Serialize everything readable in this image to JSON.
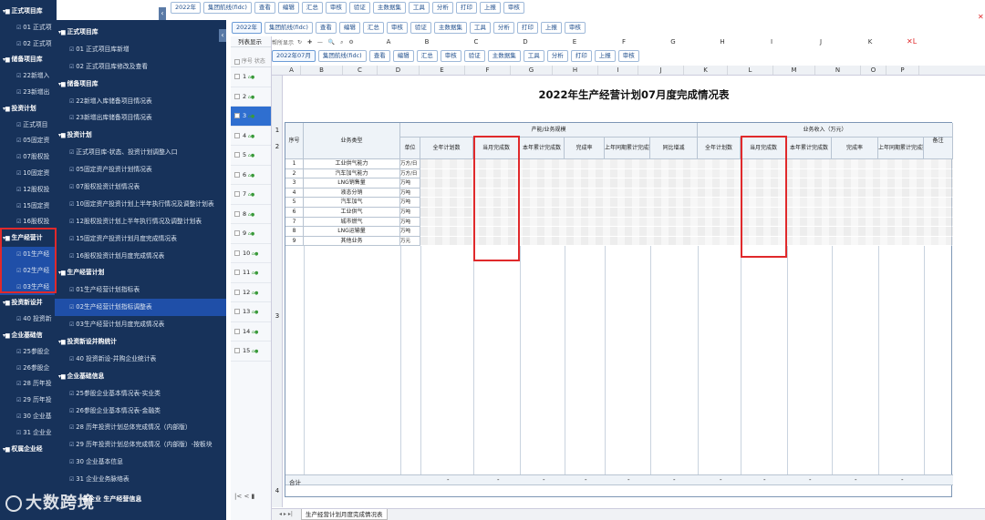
{
  "back_window": {
    "toolbar": [
      "2022年",
      "集团航线(fidc)",
      "查看",
      "编辑",
      "汇总",
      "审核",
      "验证",
      "主数据集",
      "工具",
      "分析",
      "打印",
      "上报",
      "审核"
    ],
    "tree": [
      {
        "label": "正式项目库",
        "group": true
      },
      {
        "label": "01 正式项",
        "group": false
      },
      {
        "label": "02 正式项",
        "group": false
      },
      {
        "label": "储备项目库",
        "group": true
      },
      {
        "label": "22新增入",
        "group": false
      },
      {
        "label": "23新增出",
        "group": false
      },
      {
        "label": "投资计划",
        "group": true
      },
      {
        "label": "正式项目",
        "group": false
      },
      {
        "label": "05固定资",
        "group": false
      },
      {
        "label": "07股权投",
        "group": false
      },
      {
        "label": "10固定资",
        "group": false
      },
      {
        "label": "12股权投",
        "group": false
      },
      {
        "label": "15固定资",
        "group": false
      },
      {
        "label": "16股权投",
        "group": false
      },
      {
        "label": "生产经营计",
        "group": true
      },
      {
        "label": "01生产经",
        "group": false
      },
      {
        "label": "02生产经",
        "group": false
      },
      {
        "label": "03生产经",
        "group": false
      },
      {
        "label": "投资新设并",
        "group": true
      },
      {
        "label": "40 投资新",
        "group": false
      },
      {
        "label": "企业基础信",
        "group": true
      },
      {
        "label": "25参股企",
        "group": false
      },
      {
        "label": "26参股企",
        "group": false
      },
      {
        "label": "28 历年投",
        "group": false
      },
      {
        "label": "29 历年投",
        "group": false
      },
      {
        "label": "30 企业基",
        "group": false
      },
      {
        "label": "31 企业业",
        "group": false
      },
      {
        "label": "权属企业经",
        "group": true
      }
    ]
  },
  "mid_window": {
    "toolbar": [
      "2022年",
      "集团航线(fidc)",
      "查看",
      "编辑",
      "汇总",
      "审核",
      "验证",
      "主数据集",
      "工具",
      "分析",
      "打印",
      "上报",
      "审核"
    ],
    "tree": [
      {
        "label": "正式项目库",
        "group": true,
        "indent": 1
      },
      {
        "label": "01 正式项目库新增",
        "group": false,
        "indent": 2
      },
      {
        "label": "02 正式项目库修改及查看",
        "group": false,
        "indent": 2
      },
      {
        "label": "储备项目库",
        "group": true,
        "indent": 1
      },
      {
        "label": "22新增入库储备项目情况表",
        "group": false,
        "indent": 2
      },
      {
        "label": "23新增出库储备项目情况表",
        "group": false,
        "indent": 2
      },
      {
        "label": "投资计划",
        "group": true,
        "indent": 1
      },
      {
        "label": "正式项目库-状态、投资计划调整入口",
        "group": false,
        "indent": 2
      },
      {
        "label": "05固定资产投资计划情况表",
        "group": false,
        "indent": 2
      },
      {
        "label": "07股权投资计划情况表",
        "group": false,
        "indent": 2
      },
      {
        "label": "10固定资产投资计划上半年执行情况及调整计划表",
        "group": false,
        "indent": 2
      },
      {
        "label": "12股权投资计划上半年执行情况及调整计划表",
        "group": false,
        "indent": 2
      },
      {
        "label": "15固定资产投资计划月度完成情况表",
        "group": false,
        "indent": 2
      },
      {
        "label": "16股权投资计划月度完成情况表",
        "group": false,
        "indent": 2
      },
      {
        "label": "生产经营计划",
        "group": true,
        "indent": 1
      },
      {
        "label": "01生产经营计划指标表",
        "group": false,
        "indent": 2
      },
      {
        "label": "02生产经营计划指标调整表",
        "group": false,
        "indent": 2,
        "selected": true
      },
      {
        "label": "03生产经营计划月度完成情况表",
        "group": false,
        "indent": 2
      },
      {
        "label": "投资新设并购统计",
        "group": true,
        "indent": 1
      },
      {
        "label": "40 投资新设-并购企业统计表",
        "group": false,
        "indent": 2
      },
      {
        "label": "企业基础信息",
        "group": true,
        "indent": 1
      },
      {
        "label": "25参股企业基本情况表-实业类",
        "group": false,
        "indent": 2
      },
      {
        "label": "26参股企业基本情况表-金融类",
        "group": false,
        "indent": 2
      },
      {
        "label": "28 历年投资计划总体完成情况（内部版）",
        "group": false,
        "indent": 2
      },
      {
        "label": "29 历年投资计划总体完成情况（内部版）-按板块",
        "group": false,
        "indent": 2
      },
      {
        "label": "30 企业基本信息",
        "group": false,
        "indent": 2
      },
      {
        "label": "31 企业业务脉络表",
        "group": false,
        "indent": 2
      }
    ],
    "bottom_partial": "各企业 生产经营信息"
  },
  "front_window": {
    "tab_list": "列表显示",
    "list_header": [
      "序号",
      "状态"
    ],
    "rows": [
      "1",
      "2",
      "3",
      "4",
      "5",
      "6",
      "7",
      "8",
      "9",
      "10",
      "11",
      "12",
      "13",
      "14",
      "15"
    ],
    "toolbar2": [
      "2022年07月",
      "集团航线(fidc)",
      "查看",
      "编辑",
      "汇总",
      "审核",
      "验证",
      "主数据集",
      "工具",
      "分析",
      "打印",
      "上报",
      "审核"
    ],
    "formula_label": "帮所显示",
    "col_letters_top": [
      "A",
      "B",
      "C",
      "D",
      "E",
      "F",
      "G",
      "H",
      "I",
      "J",
      "K"
    ],
    "col_letters": [
      "A",
      "B",
      "C",
      "D",
      "E",
      "F",
      "G",
      "H",
      "I",
      "J",
      "K",
      "L",
      "M",
      "N",
      "O",
      "P"
    ],
    "sheet_title": "2022年生产经营计划07月度完成情况表",
    "group_headers": {
      "prod": "产能/业务规模",
      "rev": "业务收入（万元）"
    },
    "headers": {
      "seq": "序号",
      "type": "业务类型",
      "unit": "单位",
      "annual": "全年计划数",
      "month": "当月完成数",
      "ytd": "本年累计完成数",
      "rate": "完成率",
      "last": "上年同期累计完成数",
      "yoy": "同比增减",
      "note": "备注"
    },
    "data_rows": [
      {
        "seq": "1",
        "type": "工业供气能力",
        "unit": "万方/日"
      },
      {
        "seq": "2",
        "type": "汽车加气能力",
        "unit": "万方/日"
      },
      {
        "seq": "3",
        "type": "LNG销售量",
        "unit": "万吨"
      },
      {
        "seq": "4",
        "type": "液态分销",
        "unit": "万吨"
      },
      {
        "seq": "5",
        "type": "汽车加气",
        "unit": "万吨"
      },
      {
        "seq": "6",
        "type": "工业供气",
        "unit": "万吨"
      },
      {
        "seq": "7",
        "type": "城市燃气",
        "unit": "万吨"
      },
      {
        "seq": "8",
        "type": "LNG运输量",
        "unit": "万吨"
      },
      {
        "seq": "9",
        "type": "其他业务",
        "unit": "万元"
      }
    ],
    "total_label": "合计",
    "total_dash": "-",
    "sheet_tab": "生产经营计划月度完成情况表",
    "row_nums": [
      "1",
      "2",
      "3",
      "4"
    ]
  },
  "watermark": "大数跨境",
  "colors": {
    "navy": "#17325a",
    "selected": "#1f4fa8",
    "highlight": "#e0292b",
    "accent": "#1f4e8c"
  }
}
